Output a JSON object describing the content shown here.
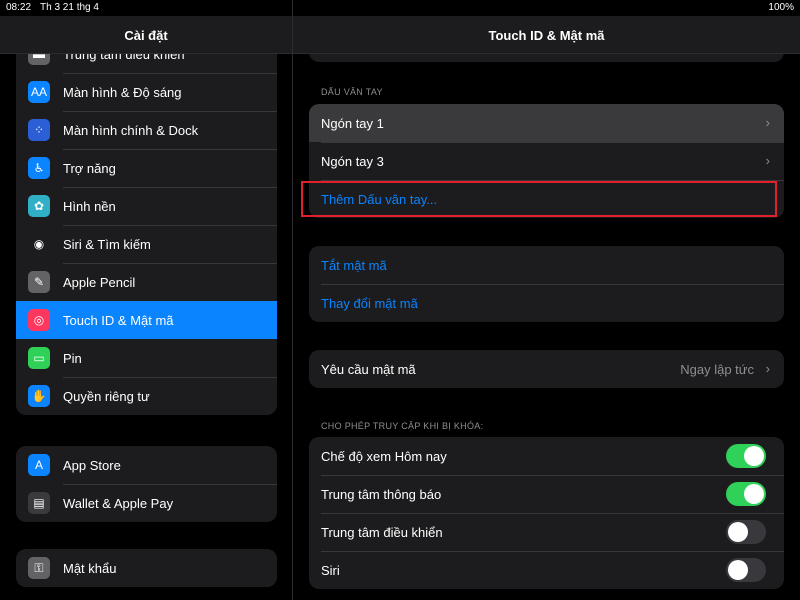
{
  "status_bar": {
    "time": "08:22",
    "date": "Th 3 21 thg 4",
    "battery": "100%"
  },
  "left": {
    "title": "Cài đặt",
    "group1": [
      {
        "label": "Trung tâm điều khiển",
        "icon": "control-center-icon",
        "color": "#636366",
        "glyph": "▬"
      },
      {
        "label": "Màn hình & Độ sáng",
        "icon": "display-brightness-icon",
        "color": "#0a84ff",
        "glyph": "AA"
      },
      {
        "label": "Màn hình chính & Dock",
        "icon": "home-screen-dock-icon",
        "color": "#2c5fd6",
        "glyph": "⁘"
      },
      {
        "label": "Trợ năng",
        "icon": "accessibility-icon",
        "color": "#0a84ff",
        "glyph": "♿"
      },
      {
        "label": "Hình nền",
        "icon": "wallpaper-icon",
        "color": "#30b0c7",
        "glyph": "✿"
      },
      {
        "label": "Siri & Tìm kiếm",
        "icon": "siri-icon",
        "color": "#1c1c1e",
        "glyph": "◉"
      },
      {
        "label": "Apple Pencil",
        "icon": "apple-pencil-icon",
        "color": "#636366",
        "glyph": "✎"
      },
      {
        "label": "Touch ID & Mật mã",
        "icon": "touch-id-icon",
        "color": "#ff375f",
        "glyph": "◎",
        "selected": true
      },
      {
        "label": "Pin",
        "icon": "battery-icon",
        "color": "#30d158",
        "glyph": "▭"
      },
      {
        "label": "Quyền riêng tư",
        "icon": "privacy-hand-icon",
        "color": "#0a84ff",
        "glyph": "✋"
      }
    ],
    "group2": [
      {
        "label": "App Store",
        "icon": "app-store-icon",
        "color": "#0a84ff",
        "glyph": "A"
      },
      {
        "label": "Wallet & Apple Pay",
        "icon": "wallet-icon",
        "color": "#3a3a3c",
        "glyph": "▤"
      }
    ],
    "group3": [
      {
        "label": "Mật khẩu",
        "icon": "passwords-key-icon",
        "color": "#636366",
        "glyph": "⚿"
      }
    ]
  },
  "right": {
    "title": "Touch ID & Mật mã",
    "fingerprint_section": "DẤU VÂN TAY",
    "fingerprints": [
      {
        "label": "Ngón tay 1"
      },
      {
        "label": "Ngón tay 3"
      }
    ],
    "add_fingerprint": "Thêm Dấu vân tay...",
    "passcode_off": "Tắt mật mã",
    "passcode_change": "Thay đổi mật mã",
    "require_passcode": {
      "label": "Yêu cầu mật mã",
      "value": "Ngay lập tức"
    },
    "locked_section": "CHO PHÉP TRUY CẬP KHI BỊ KHÓA:",
    "locked_access": [
      {
        "label": "Chế độ xem Hôm nay",
        "on": true
      },
      {
        "label": "Trung tâm thông báo",
        "on": true
      },
      {
        "label": "Trung tâm điều khiển",
        "on": false
      },
      {
        "label": "Siri",
        "on": false
      }
    ]
  }
}
